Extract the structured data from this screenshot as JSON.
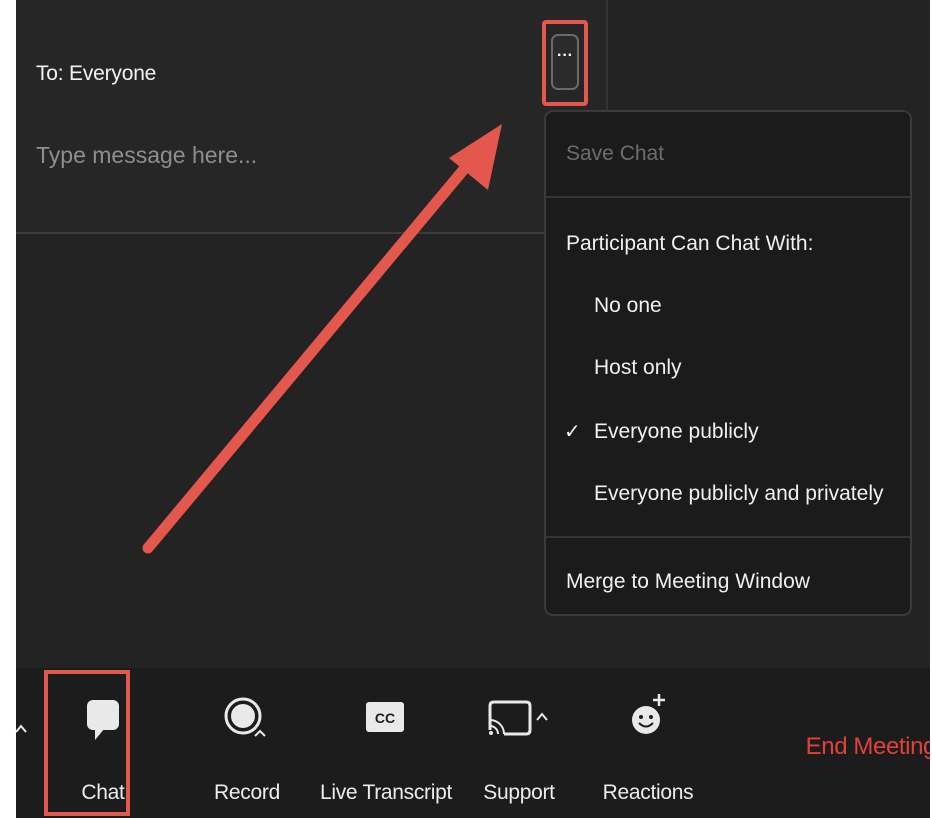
{
  "chat": {
    "to_label": "To: Everyone",
    "message_placeholder": "Type message here...",
    "message_value": "",
    "more_button_label": "···"
  },
  "menu": {
    "save_chat": "Save Chat",
    "section_header": "Participant Can Chat With:",
    "options": [
      {
        "label": "No one",
        "checked": false
      },
      {
        "label": "Host only",
        "checked": false
      },
      {
        "label": "Everyone publicly",
        "checked": true
      },
      {
        "label": "Everyone publicly and privately",
        "checked": false
      }
    ],
    "check_mark": "✓",
    "merge": "Merge to Meeting Window"
  },
  "toolbar": {
    "items": [
      {
        "label": "Chat",
        "icon": "chat-bubble-icon"
      },
      {
        "label": "Record",
        "icon": "record-icon"
      },
      {
        "label": "Live Transcript",
        "icon": "cc-icon",
        "icon_text": "CC"
      },
      {
        "label": "Support",
        "icon": "screen-cast-icon"
      },
      {
        "label": "Reactions",
        "icon": "smiley-add-icon"
      }
    ],
    "end_meeting": "End Meeting"
  },
  "colors": {
    "annotation": "#e3574d",
    "end_meeting": "#e2403a",
    "background": "#232323",
    "menu_background": "#1b1b1b"
  }
}
